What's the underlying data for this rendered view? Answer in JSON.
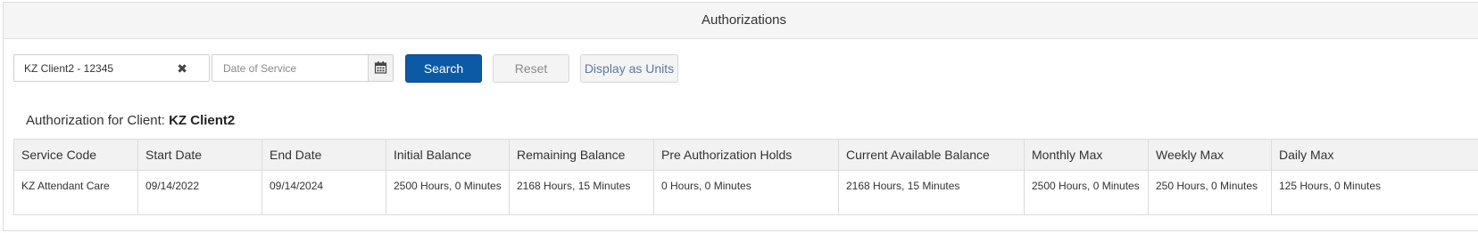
{
  "panel": {
    "title": "Authorizations"
  },
  "search": {
    "client_value": "KZ Client2 - 12345",
    "clear_glyph": "✖",
    "date_placeholder": "Date of Service",
    "calendar_icon": "calendar-icon",
    "search_label": "Search",
    "reset_label": "Reset",
    "units_label": "Display as Units"
  },
  "client_heading": {
    "prefix": "Authorization for Client:",
    "name": "KZ Client2"
  },
  "table": {
    "headers": [
      "Service Code",
      "Start Date",
      "End Date",
      "Initial Balance",
      "Remaining Balance",
      "Pre Authorization Holds",
      "Current Available Balance",
      "Monthly Max",
      "Weekly Max",
      "Daily Max"
    ],
    "rows": [
      [
        "KZ Attendant Care",
        "09/14/2022",
        "09/14/2024",
        "2500 Hours, 0 Minutes",
        "2168 Hours, 15 Minutes",
        "0 Hours, 0 Minutes",
        "2168 Hours, 15 Minutes",
        "2500 Hours, 0 Minutes",
        "250 Hours, 0 Minutes",
        "125 Hours, 0 Minutes"
      ]
    ]
  },
  "colors": {
    "primary": "#0c5aa6",
    "header_bg": "#f5f5f5",
    "border": "#dcdcdc"
  }
}
